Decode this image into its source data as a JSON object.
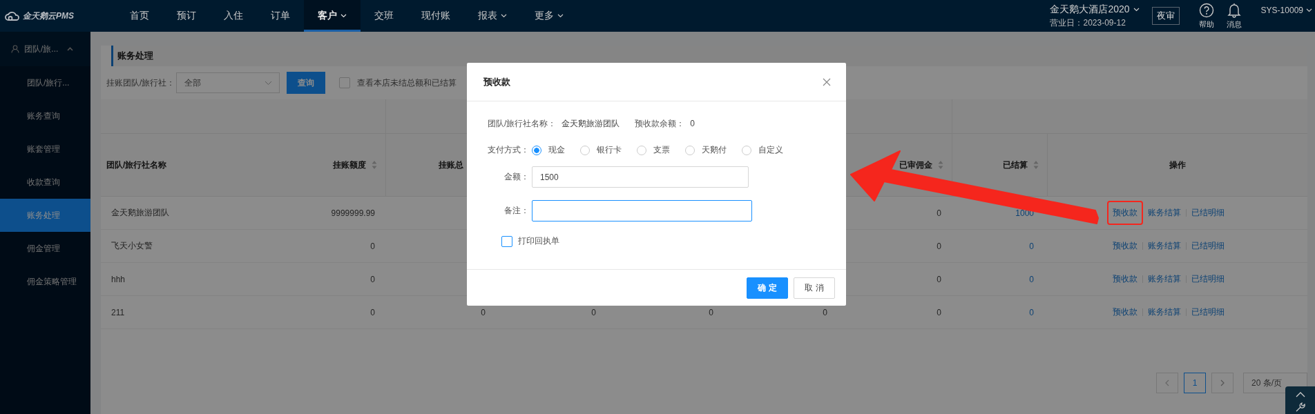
{
  "topbar": {
    "logo": "金天鹅云PMS",
    "nav": [
      {
        "label": "首页",
        "dropdown": false,
        "selected": false
      },
      {
        "label": "预订",
        "dropdown": false,
        "selected": false
      },
      {
        "label": "入住",
        "dropdown": false,
        "selected": false
      },
      {
        "label": "订单",
        "dropdown": false,
        "selected": false
      },
      {
        "label": "客户",
        "dropdown": true,
        "selected": true
      },
      {
        "label": "交班",
        "dropdown": false,
        "selected": false
      },
      {
        "label": "现付账",
        "dropdown": false,
        "selected": false
      },
      {
        "label": "报表",
        "dropdown": true,
        "selected": false
      },
      {
        "label": "更多",
        "dropdown": true,
        "selected": false
      }
    ],
    "hotel": "金天鹅大酒店2020",
    "business_date": "营业日：2023-09-12",
    "night_audit": "夜审",
    "help": "帮助",
    "messages": "消息",
    "user": "SYS-10009"
  },
  "sidebar": {
    "group": {
      "label": "团队/旅...",
      "expanded": true
    },
    "items": [
      {
        "label": "团队/旅行...",
        "selected": false
      },
      {
        "label": "账务查询",
        "selected": false
      },
      {
        "label": "账套管理",
        "selected": false
      },
      {
        "label": "收款查询",
        "selected": false
      },
      {
        "label": "账务处理",
        "selected": true
      },
      {
        "label": "佣金管理",
        "selected": false
      },
      {
        "label": "佣金策略管理",
        "selected": false
      }
    ]
  },
  "page": {
    "title": "账务处理",
    "filter": {
      "label": "挂账团队/旅行社：",
      "value": "全部",
      "button": "查询",
      "checkbox_label": "查看本店未结总额和已结算",
      "checked": false
    },
    "table": {
      "columns": [
        {
          "label": "团队/旅行社名称",
          "sortable": false
        },
        {
          "label": "挂账额度",
          "sortable": true
        },
        {
          "label": "挂账总"
        },
        {},
        {},
        {},
        {
          "label": "已审佣金",
          "sortable": true
        },
        {
          "label": "已结算",
          "sortable": true
        },
        {
          "label": "操作",
          "sortable": false
        }
      ],
      "rows": [
        {
          "cells": [
            "金天鹅旅游团队",
            "9999999.99",
            null,
            null,
            null,
            null,
            "0",
            "1000"
          ],
          "actions": [
            "预收款",
            "账务结算",
            "已结明细"
          ],
          "highlighted": true
        },
        {
          "cells": [
            "飞天小女警",
            "0",
            null,
            null,
            null,
            null,
            "0",
            "0"
          ],
          "actions": [
            "预收款",
            "账务结算",
            "已结明细"
          ],
          "highlighted": false
        },
        {
          "cells": [
            "hhh",
            "0",
            null,
            null,
            null,
            null,
            "0",
            "0"
          ],
          "actions": [
            "预收款",
            "账务结算",
            "已结明细"
          ],
          "highlighted": false
        },
        {
          "cells": [
            "211",
            "0",
            "0",
            "0",
            "0",
            "0",
            "0",
            "0"
          ],
          "actions": [
            "预收款",
            "账务结算",
            "已结明细"
          ],
          "highlighted": false
        }
      ]
    },
    "pagination": {
      "pages": [
        {
          "label": "1",
          "selected": true
        }
      ],
      "page_size": "20 条/页"
    }
  },
  "dialog": {
    "title": "预收款",
    "name_label": "团队/旅行社名称：",
    "name_value": "金天鹅旅游团队",
    "balance_label": "预收款余额：",
    "balance_value": "0",
    "payment_label": "支付方式：",
    "payment_options": [
      {
        "label": "现金",
        "selected": true
      },
      {
        "label": "银行卡",
        "selected": false
      },
      {
        "label": "支票",
        "selected": false
      },
      {
        "label": "天鹅付",
        "selected": false
      },
      {
        "label": "自定义",
        "selected": false
      }
    ],
    "fields": [
      {
        "label": "金额：",
        "value": "1500",
        "focused": false
      },
      {
        "label": "备注：",
        "focused": true
      }
    ],
    "print_receipt": {
      "label": "打印回执单",
      "checked": false
    },
    "buttons": [
      {
        "label": "确 定",
        "kind": "primary"
      },
      {
        "label": "取 消",
        "kind": "default"
      }
    ]
  }
}
